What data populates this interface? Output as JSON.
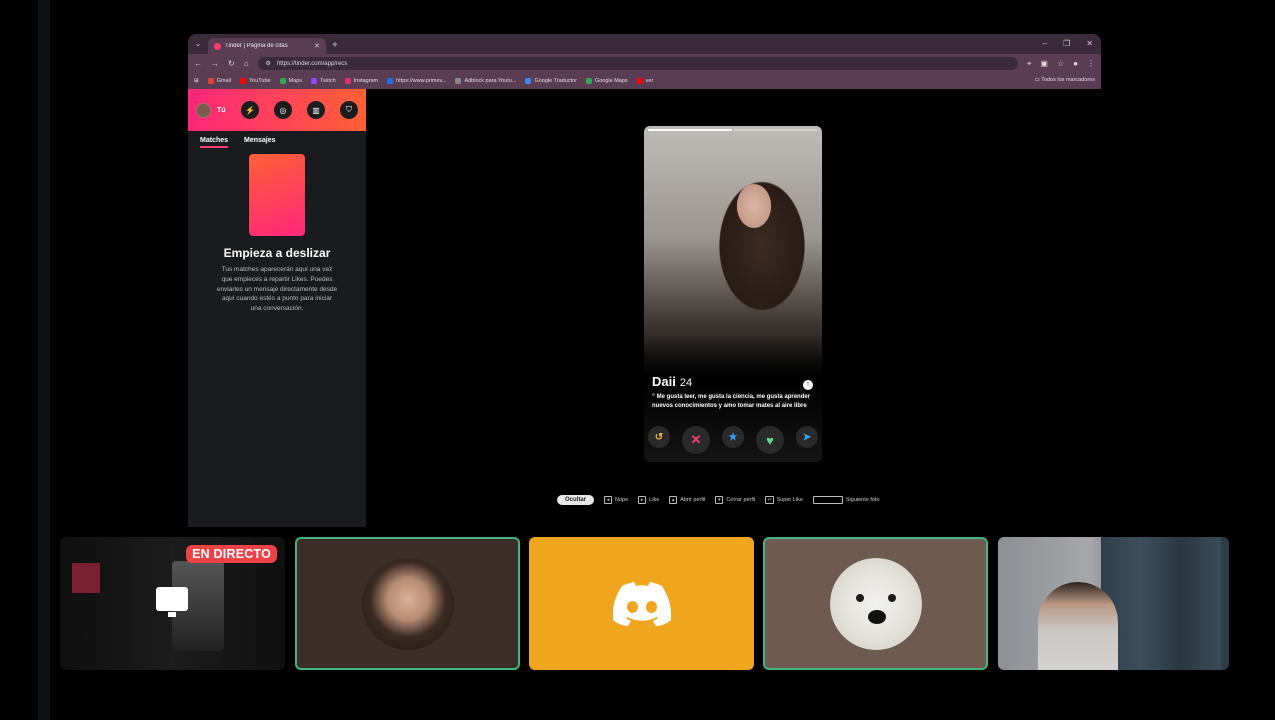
{
  "browser": {
    "tab_title": "Tinder | Pagina de citas",
    "url": "https://tinder.com/app/recs",
    "bookmarks": [
      {
        "label": "Gmail",
        "color": "#ea4335"
      },
      {
        "label": "YouTube",
        "color": "#ff0000"
      },
      {
        "label": "Maps",
        "color": "#34a853"
      },
      {
        "label": "Twitch",
        "color": "#9146ff"
      },
      {
        "label": "Instagram",
        "color": "#e1306c"
      },
      {
        "label": "https://www.primev...",
        "color": "#1a73e8"
      },
      {
        "label": "Adblock para Youtu...",
        "color": "#888888"
      },
      {
        "label": "Google Traductor",
        "color": "#4285f4"
      },
      {
        "label": "Google Maps",
        "color": "#34a853"
      },
      {
        "label": "ver",
        "color": "#ff0000"
      }
    ],
    "all_bookmarks": "Todos los marcadores"
  },
  "sidebar": {
    "user_name": "Tú",
    "tabs": [
      "Matches",
      "Mensajes"
    ],
    "heading": "Empieza a deslizar",
    "description": "Tus matches aparecerán aquí una vez que empieces a repartir Likes. Puedes enviarles un mensaje directamente desde aquí cuando estés a punto para iniciar una conversación."
  },
  "profile": {
    "name": "Daii",
    "age": "24",
    "bio": "“ Me gusta leer, me gusta la ciencia, me gusta aprender nuevos conocimientos y amo tomar mates al aire libre",
    "photo_count": 2,
    "active_photo": 1
  },
  "shortcuts": {
    "hide": "Ocultar",
    "items": [
      "Nope",
      "Like",
      "Abrir perfil",
      "Cerrar perfil",
      "Super Like",
      "Siguiente foto"
    ]
  },
  "call": {
    "live_badge": "EN DIRECTO"
  },
  "colors": {
    "tinder_gradient_start": "#fd267a",
    "tinder_gradient_end": "#ff6036",
    "discord_speaking": "#43b581",
    "discord_tile": "#f0a51f"
  }
}
